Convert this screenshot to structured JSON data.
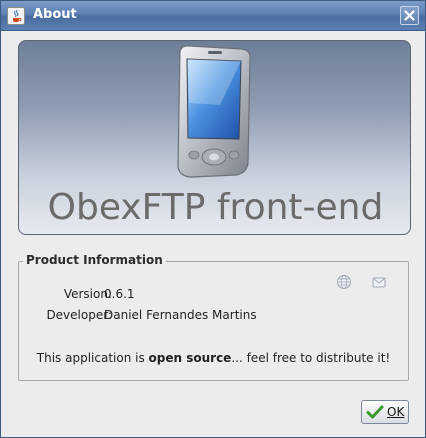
{
  "window": {
    "title": "About"
  },
  "banner": {
    "app_name": "ObexFTP front-end"
  },
  "product_info": {
    "group_label": "Product Information",
    "version_label": "Version:",
    "version_value": "0.6.1",
    "developer_label": "Developer:",
    "developer_value": "Daniel Fernandes Martins",
    "notice_before": "This application is ",
    "notice_bold": "open source",
    "notice_after": "... feel free to distribute it!"
  },
  "buttons": {
    "ok_label": "OK"
  },
  "icons": {
    "title": "java-cup-icon",
    "close": "close-icon",
    "website": "globe-icon",
    "email": "envelope-icon",
    "ok": "checkmark-icon"
  },
  "colors": {
    "titlebar": "#5c7fb1",
    "banner_top": "#6f7f98",
    "banner_bottom": "#e7eaef",
    "check_green": "#3a9a2c"
  }
}
